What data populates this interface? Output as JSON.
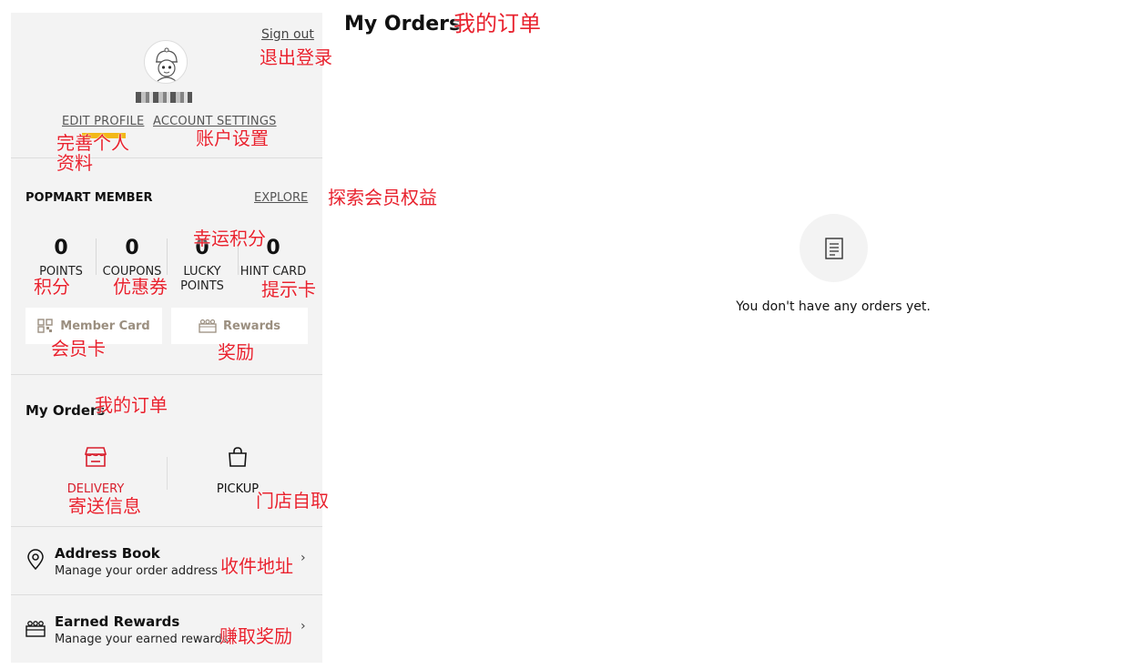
{
  "sidebar": {
    "sign_out": "Sign out",
    "edit_profile": "EDIT PROFILE",
    "account_settings": "ACCOUNT SETTINGS",
    "member": {
      "title": "POPMART MEMBER",
      "explore": "EXPLORE",
      "stats": [
        {
          "value": "0",
          "label": "POINTS"
        },
        {
          "value": "0",
          "label": "COUPONS"
        },
        {
          "value": "0",
          "label": "LUCKY POINTS"
        },
        {
          "value": "0",
          "label": "HINT CARD"
        }
      ],
      "member_card": "Member Card",
      "rewards": "Rewards"
    },
    "orders": {
      "title": "My Orders",
      "delivery": "DELIVERY",
      "pickup": "PICKUP"
    },
    "address_book": {
      "title": "Address Book",
      "subtitle": "Manage your order address"
    },
    "earned_rewards": {
      "title": "Earned Rewards",
      "subtitle": "Manage your earned rewards"
    }
  },
  "main": {
    "title": "My Orders",
    "empty_text": "You don't have any orders yet."
  },
  "annotations": {
    "main_title": "我的订单",
    "sign_out": "退出登录",
    "edit_profile": "完善个人资料",
    "account_settings": "账户设置",
    "explore": "探索会员权益",
    "lucky_points": "幸运积分",
    "points": "积分",
    "coupons": "优惠券",
    "hint_card": "提示卡",
    "member_card": "会员卡",
    "rewards": "奖励",
    "my_orders": "我的订单",
    "delivery": "寄送信息",
    "pickup": "门店自取",
    "address_book": "收件地址",
    "earned_rewards": "赚取奖励"
  },
  "colors": {
    "accent_red": "#d81e2c",
    "annotation_red": "#e8222e",
    "highlight_yellow": "#f2b817",
    "sidebar_bg": "#f3f3f3"
  },
  "icons": {
    "member_card": "qr-grid-icon",
    "rewards": "gift-row-icon",
    "delivery": "storefront-icon",
    "pickup": "shopping-bag-icon",
    "address_book": "location-pin-icon",
    "earned_rewards": "gift-row-icon",
    "empty_orders": "document-icon"
  }
}
